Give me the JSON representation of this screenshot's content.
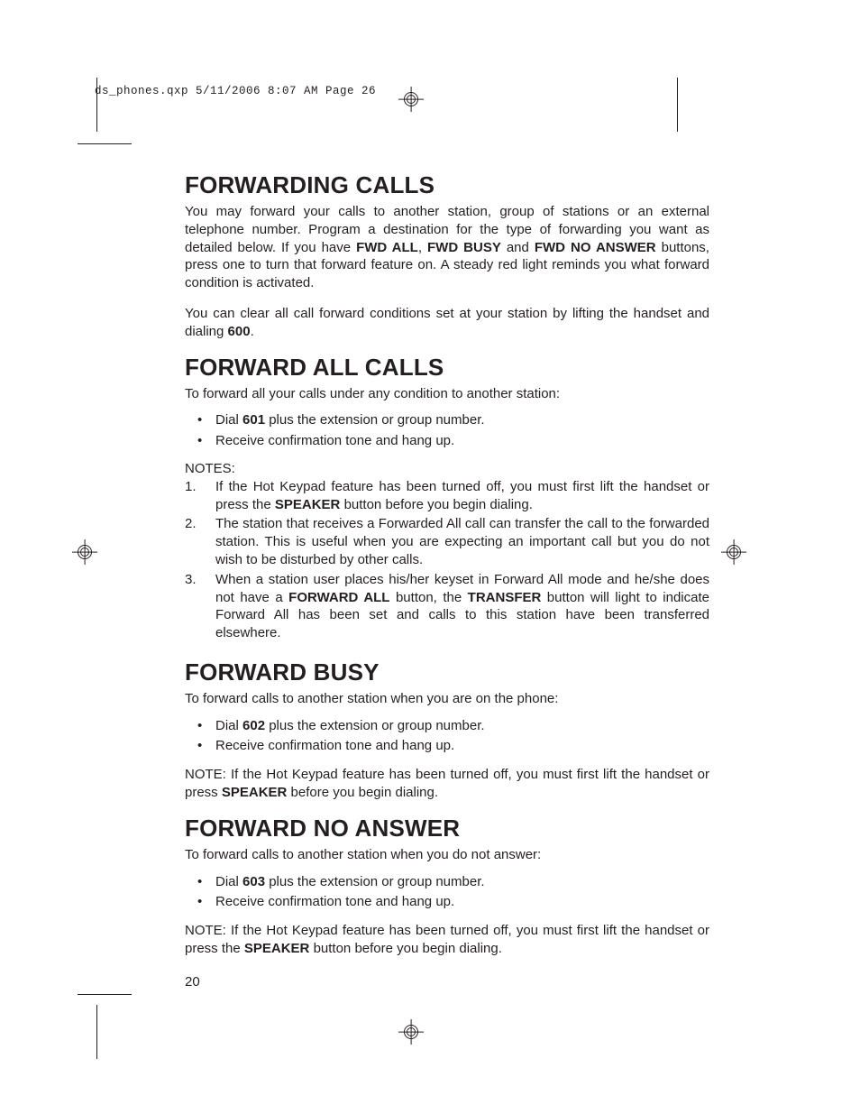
{
  "slugline": "ds_phones.qxp  5/11/2006  8:07 AM  Page 26",
  "sections": [
    {
      "heading": "FORWARDING CALLS",
      "paragraphs": [
        "You may forward your calls to another station, group of stations or an external telephone number. Program a destination for the type of forwarding you want as detailed below. If you have <b>FWD ALL</b>, <b>FWD BUSY</b> and <b>FWD NO ANSWER</b> buttons, press one to turn that forward feature on. A steady red light reminds you what forward condition is activated.",
        "You can clear all call forward conditions set at your station by lifting the handset and dialing <b>600</b>."
      ]
    },
    {
      "heading": "FORWARD ALL CALLS",
      "intro": "To forward all your calls under any condition to another station:",
      "bullets": [
        "Dial <b>601</b> plus the extension or group number.",
        "Receive confirmation tone and hang up."
      ],
      "notes_label": "NOTES:",
      "notes": [
        "If the Hot Keypad feature has been turned off, you must first lift the handset or press the <b>SPEAKER</b> button before you begin dialing.",
        "The station that receives a Forwarded All call can transfer the call to the forwarded station. This is useful when you are expecting an important call but you do not wish to be disturbed by other calls.",
        "When a station user places his/her keyset in Forward All mode and he/she does not have a <b>FORWARD ALL</b> button, the <b>TRANSFER</b> button will light to indicate Forward All has been set and calls to this station have been transferred elsewhere."
      ]
    },
    {
      "heading": "FORWARD BUSY",
      "intro": "To forward calls to another station when you are on the phone:",
      "bullets": [
        "Dial <b>602</b> plus the extension or group number.",
        "Receive confirmation tone and hang up."
      ],
      "trailing": "NOTE: If the Hot Keypad feature has been turned off, you must first lift the handset or press <b>SPEAKER</b> before you begin dialing."
    },
    {
      "heading": "FORWARD NO ANSWER",
      "intro": "To forward calls to another station when you do not answer:",
      "bullets": [
        "Dial <b>603</b> plus the extension or group number.",
        "Receive confirmation tone and hang up."
      ],
      "trailing": "NOTE: If the Hot Keypad feature has been turned off, you must first lift the handset or press the <b>SPEAKER</b> button before you begin dialing."
    }
  ],
  "page_number": "20"
}
